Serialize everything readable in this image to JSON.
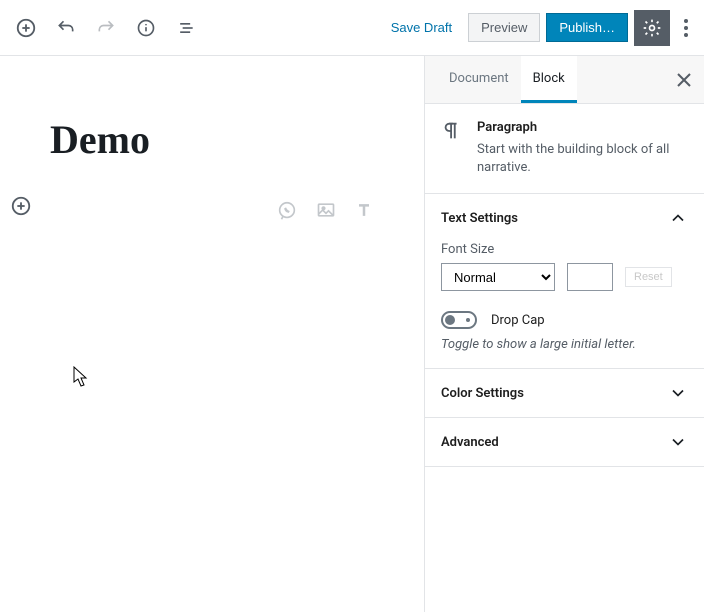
{
  "topbar": {
    "save_draft": "Save Draft",
    "preview": "Preview",
    "publish": "Publish…"
  },
  "editor": {
    "title": "Demo"
  },
  "sidebar": {
    "tabs": {
      "document": "Document",
      "block": "Block"
    },
    "block_info": {
      "title": "Paragraph",
      "desc": "Start with the building block of all narrative."
    },
    "text_settings": {
      "title": "Text Settings",
      "font_size_label": "Font Size",
      "font_size_value": "Normal",
      "reset": "Reset",
      "drop_cap": "Drop Cap",
      "drop_cap_hint": "Toggle to show a large initial letter."
    },
    "color_settings": {
      "title": "Color Settings"
    },
    "advanced": {
      "title": "Advanced"
    }
  }
}
